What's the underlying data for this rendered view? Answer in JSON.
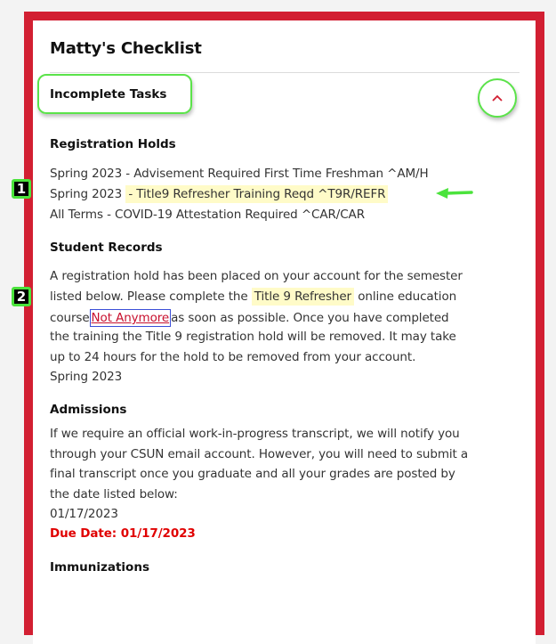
{
  "checklist": {
    "title": "Matty's Checklist",
    "section_label": "Incomplete Tasks",
    "toggle_icon": "chevron-up-icon",
    "colors": {
      "frame": "#d21f32",
      "highlight": "#fffbc8",
      "annotation": "#5be34a",
      "link": "#c8102e",
      "due": "#e00000"
    }
  },
  "registration_holds": {
    "heading": "Registration Holds",
    "items": [
      {
        "prefix": "Spring 2023 - ",
        "text": "Advisement Required First Time Freshman ^AM/H"
      },
      {
        "prefix": "Spring 2023 ",
        "text": "- Title9 Refresher Training Reqd ^T9R/REFR"
      },
      {
        "prefix": "All Terms - ",
        "text": "COVID-19 Attestation Required ^CAR/CAR"
      }
    ]
  },
  "student_records": {
    "heading": "Student Records",
    "lines": [
      "A registration hold has been placed on your account for the semester",
      "listed below. Please complete the ",
      "Title 9 Refresher",
      " online education",
      "course",
      "Not Anymore",
      "as soon as possible. Once you have completed",
      "the training the Title 9 registration hold will be removed. It may take",
      "up to 24 hours for the hold to be removed from your account.",
      "Spring 2023"
    ]
  },
  "admissions": {
    "heading": "Admissions",
    "lines": [
      "If we require an official work-in-progress transcript, we will notify you",
      "through your CSUN email account. However, you will need to submit a",
      "final transcript once you graduate and all your grades are posted by",
      "the date listed below:",
      "01/17/2023"
    ],
    "due_date": "Due Date: 01/17/2023"
  },
  "immunizations": {
    "heading": "Immunizations"
  },
  "annotations": {
    "badge1": "1",
    "badge2": "2"
  }
}
